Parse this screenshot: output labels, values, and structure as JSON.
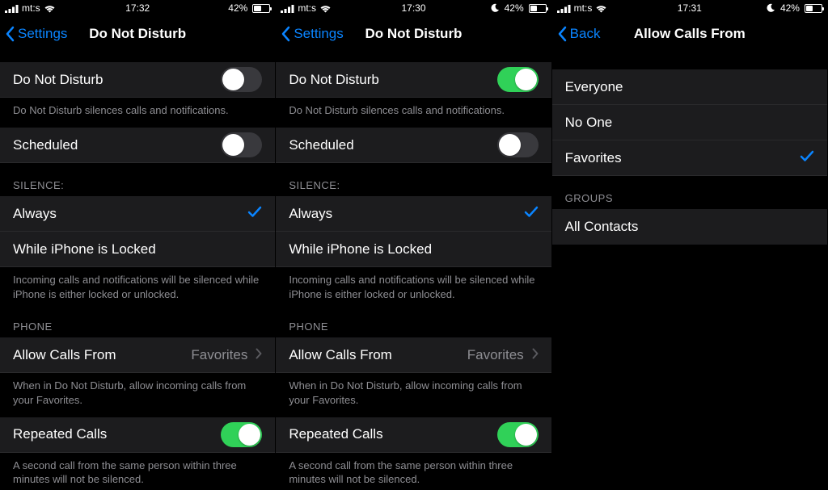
{
  "screens": [
    {
      "status": {
        "carrier": "mt:s",
        "time": "17:32",
        "battery_pct": "42%",
        "battery_fill": 42,
        "dnd_icon": false
      },
      "nav": {
        "back": "Settings",
        "title": "Do Not Disturb"
      },
      "dnd": {
        "label": "Do Not Disturb",
        "on": false,
        "footer": "Do Not Disturb silences calls and notifications."
      },
      "scheduled": {
        "label": "Scheduled",
        "on": false
      },
      "silence": {
        "header": "SILENCE:",
        "options": [
          {
            "label": "Always",
            "selected": true
          },
          {
            "label": "While iPhone is Locked",
            "selected": false
          }
        ],
        "footer": "Incoming calls and notifications will be silenced while iPhone is either locked or unlocked."
      },
      "phone": {
        "header": "PHONE",
        "allow_calls": {
          "label": "Allow Calls From",
          "value": "Favorites"
        },
        "allow_footer": "When in Do Not Disturb, allow incoming calls from your Favorites.",
        "repeated": {
          "label": "Repeated Calls",
          "on": true
        },
        "repeated_footer": "A second call from the same person within three minutes will not be silenced."
      }
    },
    {
      "status": {
        "carrier": "mt:s",
        "time": "17:30",
        "battery_pct": "42%",
        "battery_fill": 42,
        "dnd_icon": true
      },
      "nav": {
        "back": "Settings",
        "title": "Do Not Disturb"
      },
      "dnd": {
        "label": "Do Not Disturb",
        "on": true,
        "footer": "Do Not Disturb silences calls and notifications."
      },
      "scheduled": {
        "label": "Scheduled",
        "on": false
      },
      "silence": {
        "header": "SILENCE:",
        "options": [
          {
            "label": "Always",
            "selected": true
          },
          {
            "label": "While iPhone is Locked",
            "selected": false
          }
        ],
        "footer": "Incoming calls and notifications will be silenced while iPhone is either locked or unlocked."
      },
      "phone": {
        "header": "PHONE",
        "allow_calls": {
          "label": "Allow Calls From",
          "value": "Favorites"
        },
        "allow_footer": "When in Do Not Disturb, allow incoming calls from your Favorites.",
        "repeated": {
          "label": "Repeated Calls",
          "on": true
        },
        "repeated_footer": "A second call from the same person within three minutes will not be silenced."
      }
    },
    {
      "status": {
        "carrier": "mt:s",
        "time": "17:31",
        "battery_pct": "42%",
        "battery_fill": 42,
        "dnd_icon": true
      },
      "nav": {
        "back": "Back",
        "title": "Allow Calls From"
      },
      "allow_options": [
        {
          "label": "Everyone",
          "selected": false
        },
        {
          "label": "No One",
          "selected": false
        },
        {
          "label": "Favorites",
          "selected": true
        }
      ],
      "groups": {
        "header": "GROUPS",
        "items": [
          {
            "label": "All Contacts",
            "selected": false
          }
        ]
      }
    }
  ]
}
